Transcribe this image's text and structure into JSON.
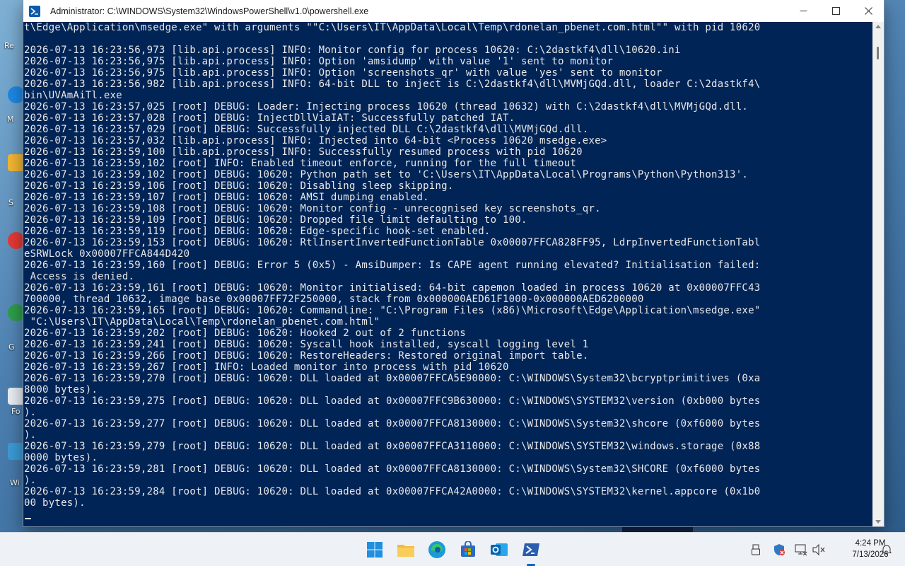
{
  "window": {
    "title": "Administrator: C:\\WINDOWS\\System32\\WindowsPowerShell\\v1.0\\powershell.exe"
  },
  "console": {
    "lines": [
      "t\\Edge\\Application\\msedge.exe\" with arguments \"\"C:\\Users\\IT\\AppData\\Local\\Temp\\rdonelan_pbenet.com.html\"\" with pid 10620",
      "",
      "2026-07-13 16:23:56,973 [lib.api.process] INFO: Monitor config for process 10620: C:\\2dastkf4\\dll\\10620.ini",
      "2026-07-13 16:23:56,975 [lib.api.process] INFO: Option 'amsidump' with value '1' sent to monitor",
      "2026-07-13 16:23:56,975 [lib.api.process] INFO: Option 'screenshots_qr' with value 'yes' sent to monitor",
      "2026-07-13 16:23:56,982 [lib.api.process] INFO: 64-bit DLL to inject is C:\\2dastkf4\\dll\\MVMjGQd.dll, loader C:\\2dastkf4\\",
      "bin\\UVAmAiTl.exe",
      "2026-07-13 16:23:57,025 [root] DEBUG: Loader: Injecting process 10620 (thread 10632) with C:\\2dastkf4\\dll\\MVMjGQd.dll.",
      "2026-07-13 16:23:57,028 [root] DEBUG: InjectDllViaIAT: Successfully patched IAT.",
      "2026-07-13 16:23:57,029 [root] DEBUG: Successfully injected DLL C:\\2dastkf4\\dll\\MVMjGQd.dll.",
      "2026-07-13 16:23:57,032 [lib.api.process] INFO: Injected into 64-bit <Process 10620 msedge.exe>",
      "2026-07-13 16:23:59,100 [lib.api.process] INFO: Successfully resumed process with pid 10620",
      "2026-07-13 16:23:59,102 [root] INFO: Enabled timeout enforce, running for the full timeout",
      "2026-07-13 16:23:59,102 [root] DEBUG: 10620: Python path set to 'C:\\Users\\IT\\AppData\\Local\\Programs\\Python\\Python313'.",
      "2026-07-13 16:23:59,106 [root] DEBUG: 10620: Disabling sleep skipping.",
      "2026-07-13 16:23:59,107 [root] DEBUG: 10620: AMSI dumping enabled.",
      "2026-07-13 16:23:59,108 [root] DEBUG: 10620: Monitor config - unrecognised key screenshots_qr.",
      "2026-07-13 16:23:59,109 [root] DEBUG: 10620: Dropped file limit defaulting to 100.",
      "2026-07-13 16:23:59,119 [root] DEBUG: 10620: Edge-specific hook-set enabled.",
      "2026-07-13 16:23:59,153 [root] DEBUG: 10620: RtlInsertInvertedFunctionTable 0x00007FFCA828FF95, LdrpInvertedFunctionTabl",
      "eSRWLock 0x00007FFCA844D420",
      "2026-07-13 16:23:59,160 [root] DEBUG: Error 5 (0x5) - AmsiDumper: Is CAPE agent running elevated? Initialisation failed:",
      " Access is denied.",
      "2026-07-13 16:23:59,161 [root] DEBUG: 10620: Monitor initialised: 64-bit capemon loaded in process 10620 at 0x00007FFC43",
      "700000, thread 10632, image base 0x00007FF72F250000, stack from 0x000000AED61F1000-0x000000AED6200000",
      "2026-07-13 16:23:59,165 [root] DEBUG: 10620: Commandline: \"C:\\Program Files (x86)\\Microsoft\\Edge\\Application\\msedge.exe\"",
      " \"C:\\Users\\IT\\AppData\\Local\\Temp\\rdonelan_pbenet.com.html\"",
      "2026-07-13 16:23:59,202 [root] DEBUG: 10620: Hooked 2 out of 2 functions",
      "2026-07-13 16:23:59,241 [root] DEBUG: 10620: Syscall hook installed, syscall logging level 1",
      "2026-07-13 16:23:59,266 [root] DEBUG: 10620: RestoreHeaders: Restored original import table.",
      "2026-07-13 16:23:59,267 [root] INFO: Loaded monitor into process with pid 10620",
      "2026-07-13 16:23:59,270 [root] DEBUG: 10620: DLL loaded at 0x00007FFCA5E90000: C:\\WINDOWS\\System32\\bcryptprimitives (0xa",
      "8000 bytes).",
      "2026-07-13 16:23:59,275 [root] DEBUG: 10620: DLL loaded at 0x00007FFC9B630000: C:\\WINDOWS\\SYSTEM32\\version (0xb000 bytes",
      ").",
      "2026-07-13 16:23:59,277 [root] DEBUG: 10620: DLL loaded at 0x00007FFCA8130000: C:\\WINDOWS\\System32\\shcore (0xf6000 bytes",
      ").",
      "2026-07-13 16:23:59,279 [root] DEBUG: 10620: DLL loaded at 0x00007FFCA3110000: C:\\WINDOWS\\SYSTEM32\\windows.storage (0x88",
      "0000 bytes).",
      "2026-07-13 16:23:59,281 [root] DEBUG: 10620: DLL loaded at 0x00007FFCA8130000: C:\\WINDOWS\\System32\\SHCORE (0xf6000 bytes",
      ").",
      "2026-07-13 16:23:59,284 [root] DEBUG: 10620: DLL loaded at 0x00007FFCA42A0000: C:\\WINDOWS\\SYSTEM32\\kernel.appcore (0x1b0",
      "00 bytes)."
    ]
  },
  "desktop": {
    "labels": [
      "Re",
      "M",
      "S",
      "G",
      "Fo",
      "Wi"
    ]
  },
  "taskbar": {
    "clock_time": "4:24 PM",
    "clock_date": "7/13/2026",
    "apps": [
      "start-icon",
      "file-explorer-icon",
      "edge-icon",
      "store-icon",
      "outlook-icon",
      "powershell-icon"
    ],
    "tray": [
      "usb-icon",
      "security-icon",
      "network-icon",
      "volume-icon",
      "notification-icon"
    ]
  },
  "colors": {
    "console_bg": "#012456",
    "console_fg": "#e8e8e8",
    "taskbar_bg": "#eef1f6",
    "accent": "#0067c0"
  }
}
